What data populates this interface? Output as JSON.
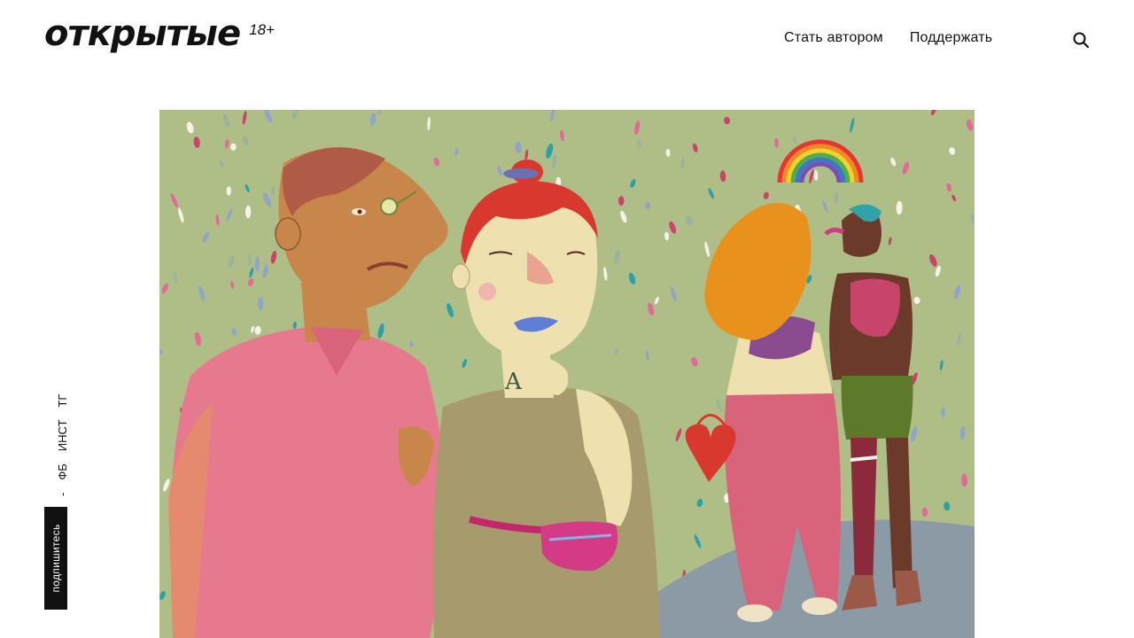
{
  "header": {
    "logo": "открытые",
    "age_rating": "18+",
    "nav": [
      {
        "label": "Стать автором"
      },
      {
        "label": "Поддержать"
      }
    ],
    "search_icon": "search-icon"
  },
  "sidebar": {
    "social": [
      {
        "label": "ТГ"
      },
      {
        "label": "ИНСТ"
      },
      {
        "label": "ФБ"
      }
    ],
    "separator": "-",
    "subscribe_label": "подпишитесь"
  },
  "hero": {
    "illustration": "colorful-people-illustration",
    "colors": {
      "background": "#afbe86",
      "shirt_pink": "#e6798e",
      "red_hair": "#d9382f",
      "orange_hair": "#e8921d",
      "blue_lips": "#5f7fd6",
      "jeans": "#d9637a",
      "shorts": "#5d7a2a",
      "ground": "#8c9aa6"
    }
  }
}
